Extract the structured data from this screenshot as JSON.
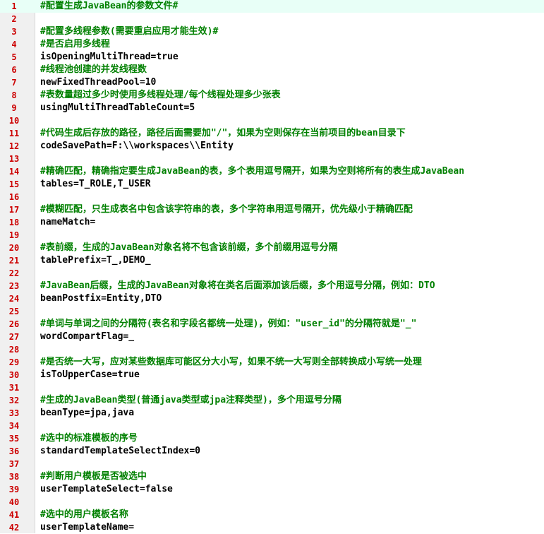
{
  "lines": [
    {
      "n": "1",
      "type": "comment",
      "text": "#配置生成JavaBean的参数文件#"
    },
    {
      "n": "2",
      "type": "blank"
    },
    {
      "n": "3",
      "type": "comment",
      "text": "#配置多线程参数(需要重启应用才能生效)#"
    },
    {
      "n": "4",
      "type": "comment",
      "text": "#是否启用多线程"
    },
    {
      "n": "5",
      "type": "prop",
      "key": "isOpeningMultiThread",
      "value": "true"
    },
    {
      "n": "6",
      "type": "comment",
      "text": "#线程池创建的并发线程数"
    },
    {
      "n": "7",
      "type": "prop",
      "key": "newFixedThreadPool",
      "value": "10"
    },
    {
      "n": "8",
      "type": "comment",
      "text": "#表数量超过多少时使用多线程处理/每个线程处理多少张表"
    },
    {
      "n": "9",
      "type": "prop",
      "key": "usingMultiThreadTableCount",
      "value": "5"
    },
    {
      "n": "10",
      "type": "blank"
    },
    {
      "n": "11",
      "type": "comment",
      "text": "#代码生成后存放的路径，路径后面需要加\"/\"，如果为空则保存在当前项目的bean目录下"
    },
    {
      "n": "12",
      "type": "prop",
      "key": "codeSavePath",
      "value": "F:\\\\workspaces\\\\Entity"
    },
    {
      "n": "13",
      "type": "blank"
    },
    {
      "n": "14",
      "type": "comment",
      "text": "#精确匹配，精确指定要生成JavaBean的表，多个表用逗号隔开，如果为空则将所有的表生成JavaBean"
    },
    {
      "n": "15",
      "type": "prop",
      "key": "tables",
      "value": "T_ROLE,T_USER"
    },
    {
      "n": "16",
      "type": "blank"
    },
    {
      "n": "17",
      "type": "comment",
      "text": "#模糊匹配，只生成表名中包含该字符串的表，多个字符串用逗号隔开，优先级小于精确匹配"
    },
    {
      "n": "18",
      "type": "prop",
      "key": "nameMatch",
      "value": ""
    },
    {
      "n": "19",
      "type": "blank"
    },
    {
      "n": "20",
      "type": "comment",
      "text": "#表前缀，生成的JavaBean对象名将不包含该前缀，多个前缀用逗号分隔"
    },
    {
      "n": "21",
      "type": "prop",
      "key": "tablePrefix",
      "value": "T_,DEMO_"
    },
    {
      "n": "22",
      "type": "blank"
    },
    {
      "n": "23",
      "type": "comment",
      "text": "#JavaBean后缀，生成的JavaBean对象将在类名后面添加该后缀，多个用逗号分隔，例如：DTO"
    },
    {
      "n": "24",
      "type": "prop",
      "key": "beanPostfix",
      "value": "Entity,DTO"
    },
    {
      "n": "25",
      "type": "blank"
    },
    {
      "n": "26",
      "type": "comment",
      "text": "#单词与单词之间的分隔符(表名和字段名都统一处理)，例如：\"user_id\"的分隔符就是\"_\""
    },
    {
      "n": "27",
      "type": "prop",
      "key": "wordCompartFlag",
      "value": "_"
    },
    {
      "n": "28",
      "type": "blank"
    },
    {
      "n": "29",
      "type": "comment",
      "text": "#是否统一大写，应对某些数据库可能区分大小写，如果不统一大写则全部转换成小写统一处理"
    },
    {
      "n": "30",
      "type": "prop",
      "key": "isToUpperCase",
      "value": "true"
    },
    {
      "n": "31",
      "type": "blank"
    },
    {
      "n": "32",
      "type": "comment",
      "text": "#生成的JavaBean类型(普通java类型或jpa注释类型)，多个用逗号分隔"
    },
    {
      "n": "33",
      "type": "prop",
      "key": "beanType",
      "value": "jpa,java"
    },
    {
      "n": "34",
      "type": "blank"
    },
    {
      "n": "35",
      "type": "comment",
      "text": "#选中的标准模板的序号"
    },
    {
      "n": "36",
      "type": "prop",
      "key": "standardTemplateSelectIndex",
      "value": "0"
    },
    {
      "n": "37",
      "type": "blank"
    },
    {
      "n": "38",
      "type": "comment",
      "text": "#判断用户模板是否被选中"
    },
    {
      "n": "39",
      "type": "prop",
      "key": "userTemplateSelect",
      "value": "false"
    },
    {
      "n": "40",
      "type": "blank"
    },
    {
      "n": "41",
      "type": "comment",
      "text": "#选中的用户模板名称"
    },
    {
      "n": "42",
      "type": "prop",
      "key": "userTemplateName",
      "value": ""
    }
  ]
}
